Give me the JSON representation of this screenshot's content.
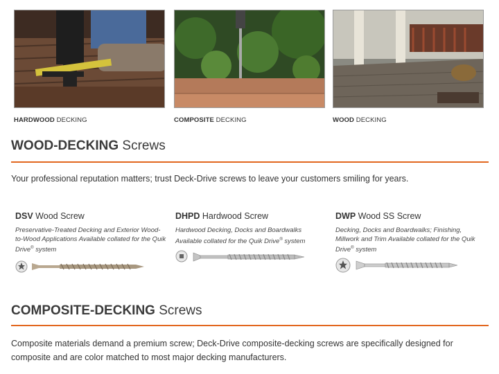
{
  "photos": [
    {
      "caption_bold": "HARDWOOD",
      "caption_rest": " DECKING"
    },
    {
      "caption_bold": "COMPOSITE",
      "caption_rest": " DECKING"
    },
    {
      "caption_bold": "WOOD",
      "caption_rest": " DECKING"
    }
  ],
  "wood_section": {
    "title_bold": "WOOD-DECKING",
    "title_rest": " Screws",
    "intro": "Your professional reputation matters; trust Deck-Drive screws to leave your customers smiling for years."
  },
  "screws": [
    {
      "code": "DSV",
      "name": " Wood Screw",
      "desc": "Preservative-Treated Decking and Exterior Wood-to-Wood Applications Available collated for the Quik Drive",
      "desc_tail": " system",
      "drive_icon": "star-drive-icon"
    },
    {
      "code": "DHPD",
      "name": " Hardwood Screw",
      "desc": "Hardwood Decking, Docks and Boardwalks Available collated for the Quik Drive",
      "desc_tail": " system",
      "drive_icon": "square-drive-icon"
    },
    {
      "code": "DWP",
      "name": " Wood SS Screw",
      "desc": "Decking, Docks and Boardwalks; Finishing, Millwork and Trim Available collated for the Quik Drive",
      "desc_tail": " system",
      "drive_icon": "star-drive-icon"
    }
  ],
  "composite_section": {
    "title_bold": "COMPOSITE-DECKING",
    "title_rest": " Screws",
    "intro": "Composite materials demand a premium screw; Deck-Drive composite-decking screws are specifically designed for composite and are color matched to most major decking manufacturers."
  },
  "registered_mark": "®",
  "colors": {
    "accent": "#e2661e",
    "text": "#333333"
  }
}
